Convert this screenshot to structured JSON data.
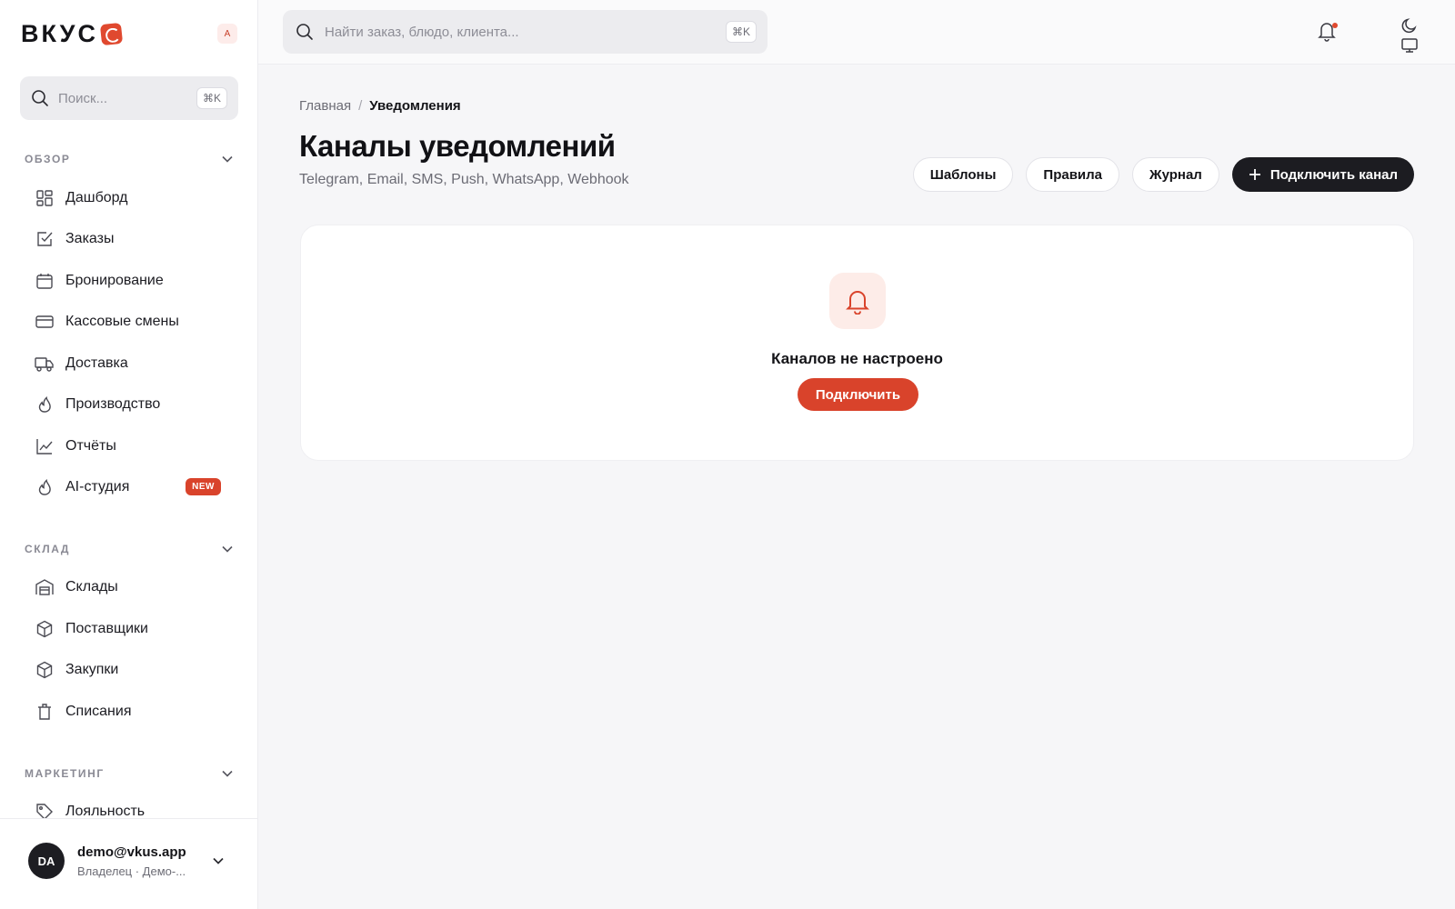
{
  "brand": {
    "name": "ВКУС",
    "lang_badge": "A"
  },
  "sidebar": {
    "search_placeholder": "Поиск...",
    "search_shortcut": "⌘K",
    "sections": [
      {
        "title": "ОБЗОР",
        "items": [
          {
            "label": "Дашборд",
            "icon": "dashboard-icon"
          },
          {
            "label": "Заказы",
            "icon": "check-square-icon"
          },
          {
            "label": "Бронирование",
            "icon": "calendar-icon"
          },
          {
            "label": "Кассовые смены",
            "icon": "card-icon"
          },
          {
            "label": "Доставка",
            "icon": "truck-icon"
          },
          {
            "label": "Производство",
            "icon": "flame-icon"
          },
          {
            "label": "Отчёты",
            "icon": "chart-line-icon"
          },
          {
            "label": "AI-студия",
            "icon": "flame-icon",
            "badge": "NEW"
          }
        ]
      },
      {
        "title": "СКЛАД",
        "items": [
          {
            "label": "Склады",
            "icon": "warehouse-icon"
          },
          {
            "label": "Поставщики",
            "icon": "box-icon"
          },
          {
            "label": "Закупки",
            "icon": "box-icon"
          },
          {
            "label": "Списания",
            "icon": "trash-icon"
          }
        ]
      },
      {
        "title": "МАРКЕТИНГ",
        "items": [
          {
            "label": "Лояльность",
            "icon": "tag-icon"
          }
        ]
      }
    ],
    "user": {
      "initials": "DA",
      "email": "demo@vkus.app",
      "role": "Владелец · Демо-..."
    }
  },
  "topbar": {
    "search_placeholder": "Найти заказ, блюдо, клиента...",
    "search_shortcut": "⌘K"
  },
  "main": {
    "breadcrumb": {
      "home": "Главная",
      "separator": "/",
      "current": "Уведомления"
    },
    "title": "Каналы уведомлений",
    "subtitle": "Telegram, Email, SMS, Push, WhatsApp, Webhook",
    "actions": {
      "templates": "Шаблоны",
      "rules": "Правила",
      "log": "Журнал",
      "connect_channel": "Подключить канал"
    },
    "empty_state": {
      "title": "Каналов не настроено",
      "button": "Подключить"
    }
  },
  "colors": {
    "accent": "#d9432b",
    "dark_button": "#1c1c21",
    "empty_icon_bg": "#fdece8"
  }
}
